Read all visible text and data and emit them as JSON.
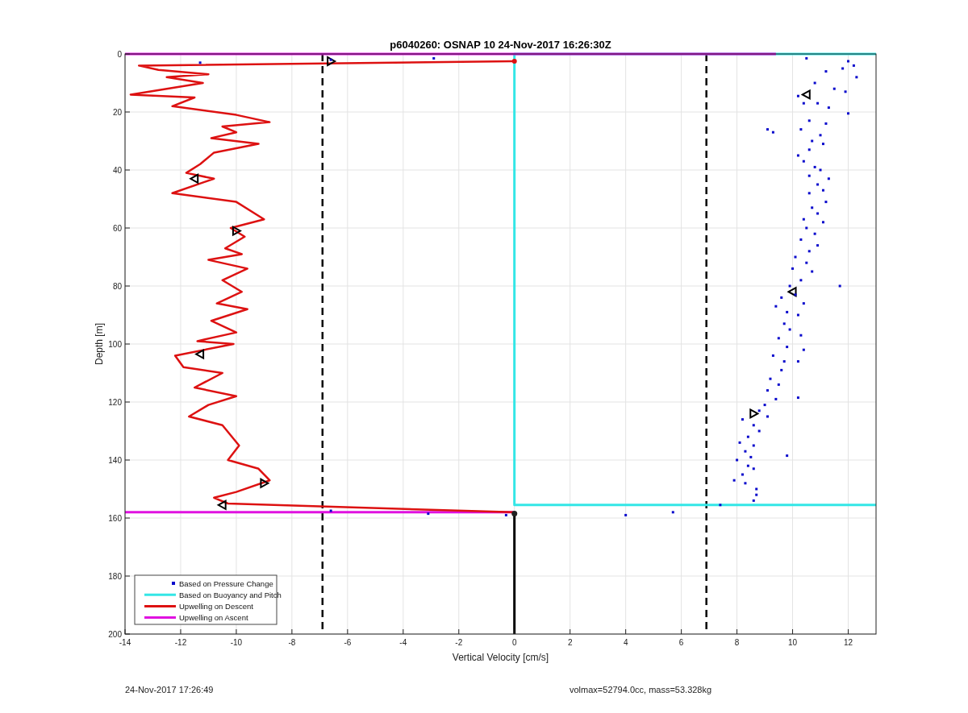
{
  "chart_data": {
    "type": "scatter",
    "grid": true,
    "legend": true,
    "title": "p6040260: OSNAP 10 24-Nov-2017 16:26:30Z",
    "xlabel": "Vertical Velocity [cm/s]",
    "ylabel": "Depth [m]",
    "xlim": [
      -14,
      13
    ],
    "ylim": [
      200,
      0
    ],
    "xticks": [
      -14,
      -12,
      -10,
      -8,
      -6,
      -4,
      -2,
      0,
      2,
      4,
      6,
      8,
      10,
      12
    ],
    "yticks": [
      0,
      20,
      40,
      60,
      80,
      100,
      120,
      140,
      160,
      180,
      200
    ],
    "series": [
      {
        "name": "Based on Pressure Change",
        "type": "scatter",
        "color": "#0a0acc",
        "x": [
          12,
          12.2,
          11.8,
          12.3,
          11.2,
          10.8,
          11.5,
          10.2,
          11.9,
          10.9,
          11.3,
          10.4,
          12,
          10.6,
          11.2,
          10.3,
          9.1,
          9.3,
          11,
          10.7,
          11.1,
          10.6,
          10.2,
          10.4,
          10.8,
          11,
          10.6,
          11.3,
          10.9,
          11.1,
          10.6,
          11.2,
          10.7,
          10.9,
          10.4,
          11.1,
          10.5,
          10.8,
          10.3,
          10.9,
          10.6,
          10.1,
          10.5,
          10,
          10.7,
          10.3,
          9.9,
          10.1,
          9.6,
          10.4,
          9.4,
          9.8,
          10.2,
          9.7,
          9.9,
          10.3,
          9.5,
          9.8,
          10.4,
          9.3,
          9.7,
          9.6,
          9.2,
          9.5,
          9.1,
          9.4,
          9,
          8.8,
          9.1,
          8.2,
          8.6,
          8.8,
          8.4,
          8.1,
          8.6,
          8.3,
          8.5,
          8,
          8.4,
          8.6,
          8.2,
          7.9,
          8.3,
          8.7,
          8.7,
          8.6,
          -11.3,
          -2.9,
          -6.6,
          -6.6,
          -3.1,
          -0.3,
          4,
          5.7,
          7.4,
          10.5,
          11.7,
          10.2,
          10.2,
          9.8
        ],
        "values": [
          2.5,
          4,
          5,
          8,
          6,
          10,
          12,
          14.5,
          13,
          17,
          18.5,
          17,
          20.5,
          23,
          24,
          26,
          26,
          27,
          28,
          30,
          31,
          33,
          35,
          37,
          39,
          40,
          42,
          43,
          45,
          47,
          48,
          51,
          53,
          55,
          57,
          58,
          60,
          62,
          64,
          66,
          68,
          70,
          72,
          74,
          75,
          78,
          80,
          83,
          84,
          86,
          87,
          89,
          90,
          93,
          95,
          97,
          98,
          101,
          102,
          104,
          106,
          109,
          112,
          114,
          116,
          119,
          121,
          123,
          125,
          126,
          128,
          130,
          132,
          134,
          135,
          137,
          139,
          140,
          142,
          143,
          145,
          147,
          148,
          150,
          152,
          154,
          3,
          1.5,
          2,
          157.5,
          158.5,
          159,
          159,
          158,
          155.5,
          1.5,
          80,
          106,
          118.5,
          138.5
        ]
      },
      {
        "name": "Based on Buoyancy and Pitch",
        "type": "line",
        "color": "#33e6e6",
        "x": [
          13,
          0,
          0,
          13
        ],
        "values": [
          0,
          0,
          155.5,
          155.5
        ]
      },
      {
        "name": "Upwelling on Descent",
        "type": "line",
        "color": "#dd1111",
        "x": [
          -0.05,
          -13.5,
          -12.8,
          -11,
          -12.5,
          -11.2,
          -13.8,
          -11.5,
          -12.3,
          -10,
          -8.8,
          -10.5,
          -10,
          -10.9,
          -9.2,
          -10.8,
          -11.3,
          -11.8,
          -10.8,
          -12.3,
          -10,
          -9,
          -10.2,
          -9.7,
          -10.4,
          -9.8,
          -11,
          -9.6,
          -10.5,
          -9.8,
          -10.7,
          -9.6,
          -10.9,
          -10,
          -11.4,
          -10.1,
          -12.2,
          -11.9,
          -10.5,
          -11.5,
          -10,
          -11,
          -11.7,
          -10.5,
          -9.9,
          -10.3,
          -9.2,
          -8.8,
          -10,
          -10.8,
          -10.3,
          -0.05
        ],
        "values": [
          2.5,
          4,
          5.5,
          7,
          8,
          10,
          14,
          15,
          18,
          21,
          23.5,
          25,
          27,
          29,
          31,
          34,
          38,
          41,
          43,
          48,
          51,
          57,
          60,
          63,
          67,
          69,
          71,
          74,
          78,
          82,
          86,
          88,
          92,
          96,
          99,
          100,
          104,
          108,
          110,
          115,
          118,
          121,
          125,
          128,
          135,
          140,
          143,
          147,
          151,
          153,
          155,
          158
        ]
      },
      {
        "name": "Upwelling on Ascent",
        "type": "line",
        "color": "#e011e0",
        "x": [
          -14,
          0,
          null,
          -14,
          9.4
        ],
        "values": [
          158,
          158,
          null,
          0,
          0
        ]
      },
      {
        "type": "line",
        "line_style": "dashed",
        "color": "#000000",
        "x": [
          -6.9,
          -6.9,
          null,
          6.9,
          6.9
        ],
        "values": [
          0,
          200,
          null,
          0,
          200
        ]
      },
      {
        "type": "line",
        "color": "#000000",
        "x": [
          0,
          0
        ],
        "values": [
          158,
          200
        ]
      },
      {
        "type": "scatter",
        "marker": "triangle-right",
        "color": "#000000",
        "x": [
          -6.6,
          -10,
          -9,
          8.6
        ],
        "values": [
          2.5,
          61,
          148,
          124
        ]
      },
      {
        "type": "scatter",
        "marker": "triangle-left",
        "color": "#000000",
        "x": [
          -11.5,
          -11.3,
          -10.5,
          10.5,
          10
        ],
        "values": [
          43,
          103.5,
          155.5,
          14,
          82
        ]
      }
    ]
  },
  "footer": {
    "timestamp": "24-Nov-2017 17:26:49",
    "info": "volmax=52794.0cc, mass=53.328kg"
  }
}
